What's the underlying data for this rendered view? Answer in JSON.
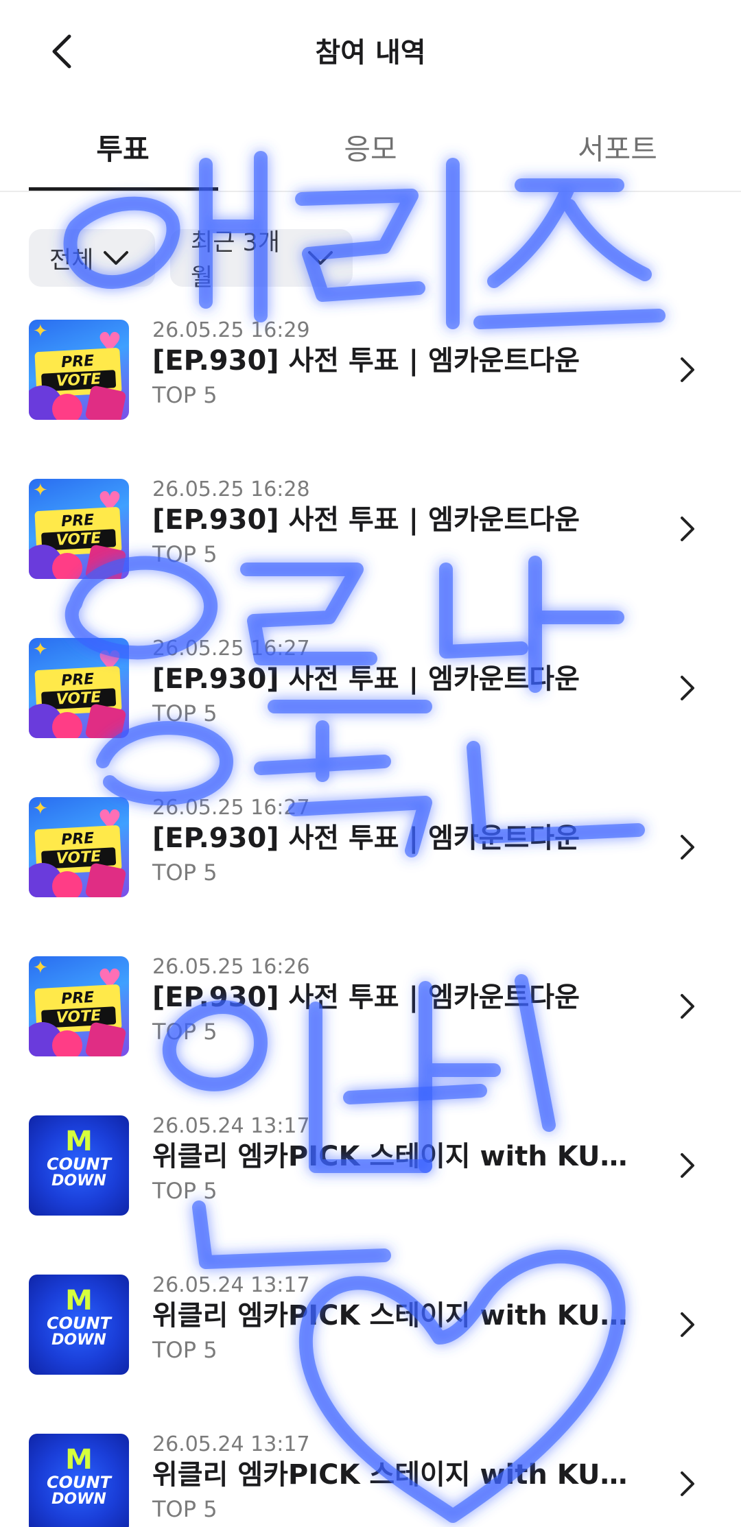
{
  "header": {
    "title": "참여 내역",
    "back_icon": "chevron-left-icon"
  },
  "tabs": [
    {
      "label": "투표",
      "active": true
    },
    {
      "label": "응모",
      "active": false
    },
    {
      "label": "서포트",
      "active": false
    }
  ],
  "filters": [
    {
      "label": "전체",
      "icon": "chevron-down-icon"
    },
    {
      "label": "최근 3개월",
      "icon": "chevron-down-icon"
    }
  ],
  "items": [
    {
      "date": "26.05.25 16:29",
      "title": "[EP.930] 사전 투표 | 엠카운트다운",
      "rank": "TOP 5",
      "thumb": "prevote"
    },
    {
      "date": "26.05.25 16:28",
      "title": "[EP.930] 사전 투표 | 엠카운트다운",
      "rank": "TOP 5",
      "thumb": "prevote"
    },
    {
      "date": "26.05.25 16:27",
      "title": "[EP.930] 사전 투표 | 엠카운트다운",
      "rank": "TOP 5",
      "thumb": "prevote"
    },
    {
      "date": "26.05.25 16:27",
      "title": "[EP.930] 사전 투표 | 엠카운트다운",
      "rank": "TOP 5",
      "thumb": "prevote"
    },
    {
      "date": "26.05.25 16:26",
      "title": "[EP.930] 사전 투표 | 엠카운트다운",
      "rank": "TOP 5",
      "thumb": "prevote"
    },
    {
      "date": "26.05.24 13:17",
      "title": "위클리 엠카PICK 스테이지 with KURAT...",
      "rank": "TOP 5",
      "thumb": "countdown"
    },
    {
      "date": "26.05.24 13:17",
      "title": "위클리 엠카PICK 스테이지 with KURAT...",
      "rank": "TOP 5",
      "thumb": "countdown"
    },
    {
      "date": "26.05.24 13:17",
      "title": "위클리 엠카PICK 스테이지 with KURAT...",
      "rank": "TOP 5",
      "thumb": "countdown"
    }
  ],
  "thumb_text": {
    "prevote": {
      "line1": "PRE",
      "line2": "VOTE"
    },
    "countdown": {
      "line1": "M",
      "line2": "COUNT",
      "line3": "DOWN"
    }
  },
  "colors": {
    "text_primary": "#1c1c1e",
    "text_secondary": "#7b7b7b",
    "chip_bg": "#eeeff2",
    "scribble": "#3a63ff"
  }
}
